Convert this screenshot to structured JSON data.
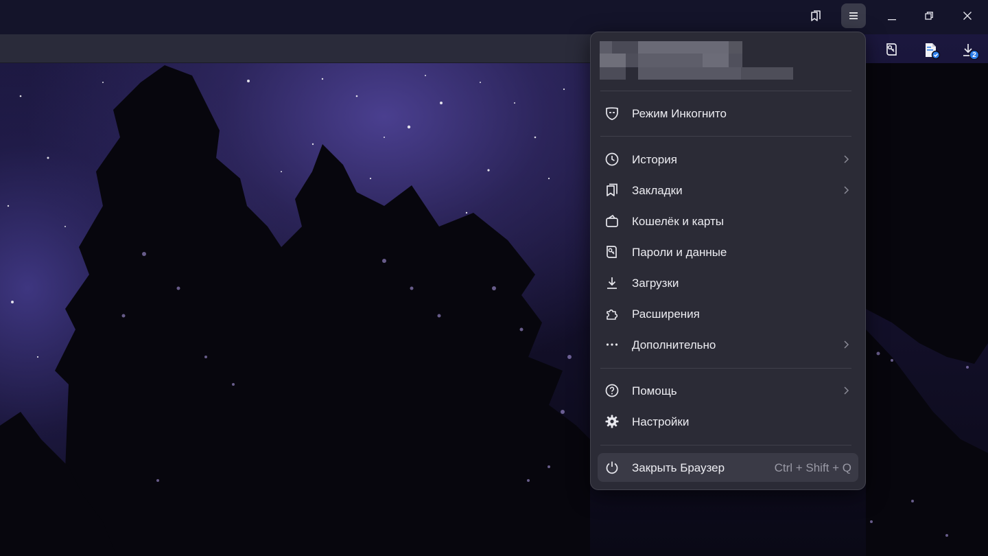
{
  "menu": {
    "items": [
      {
        "label": "Режим Инкогнито",
        "icon": "incognito-mask-icon",
        "submenu": false
      },
      {
        "label": "История",
        "icon": "clock-icon",
        "submenu": true
      },
      {
        "label": "Закладки",
        "icon": "bookmarks-icon",
        "submenu": true
      },
      {
        "label": "Кошелёк и карты",
        "icon": "wallet-icon",
        "submenu": false
      },
      {
        "label": "Пароли и данные",
        "icon": "key-card-icon",
        "submenu": false
      },
      {
        "label": "Загрузки",
        "icon": "download-icon",
        "submenu": false
      },
      {
        "label": "Расширения",
        "icon": "puzzle-icon",
        "submenu": false
      },
      {
        "label": "Дополнительно",
        "icon": "more-dots-icon",
        "submenu": true
      },
      {
        "label": "Помощь",
        "icon": "help-circle-icon",
        "submenu": true
      },
      {
        "label": "Настройки",
        "icon": "gear-icon",
        "submenu": false
      },
      {
        "label": "Закрыть Браузер",
        "icon": "power-icon",
        "shortcut": "Ctrl + Shift + Q",
        "highlighted": true
      }
    ]
  },
  "toolbar": {
    "downloads_badge": "2",
    "icons": [
      "bookmarks-panel-icon",
      "menu-hamburger-icon",
      "minimize-icon",
      "restore-icon",
      "close-icon",
      "passwords-icon",
      "document-check-icon",
      "downloads-icon"
    ]
  },
  "colors": {
    "menu_bg": "#2b2b36",
    "accent_badge": "#2b7de9",
    "annotation_arrow": "#e2262b"
  }
}
